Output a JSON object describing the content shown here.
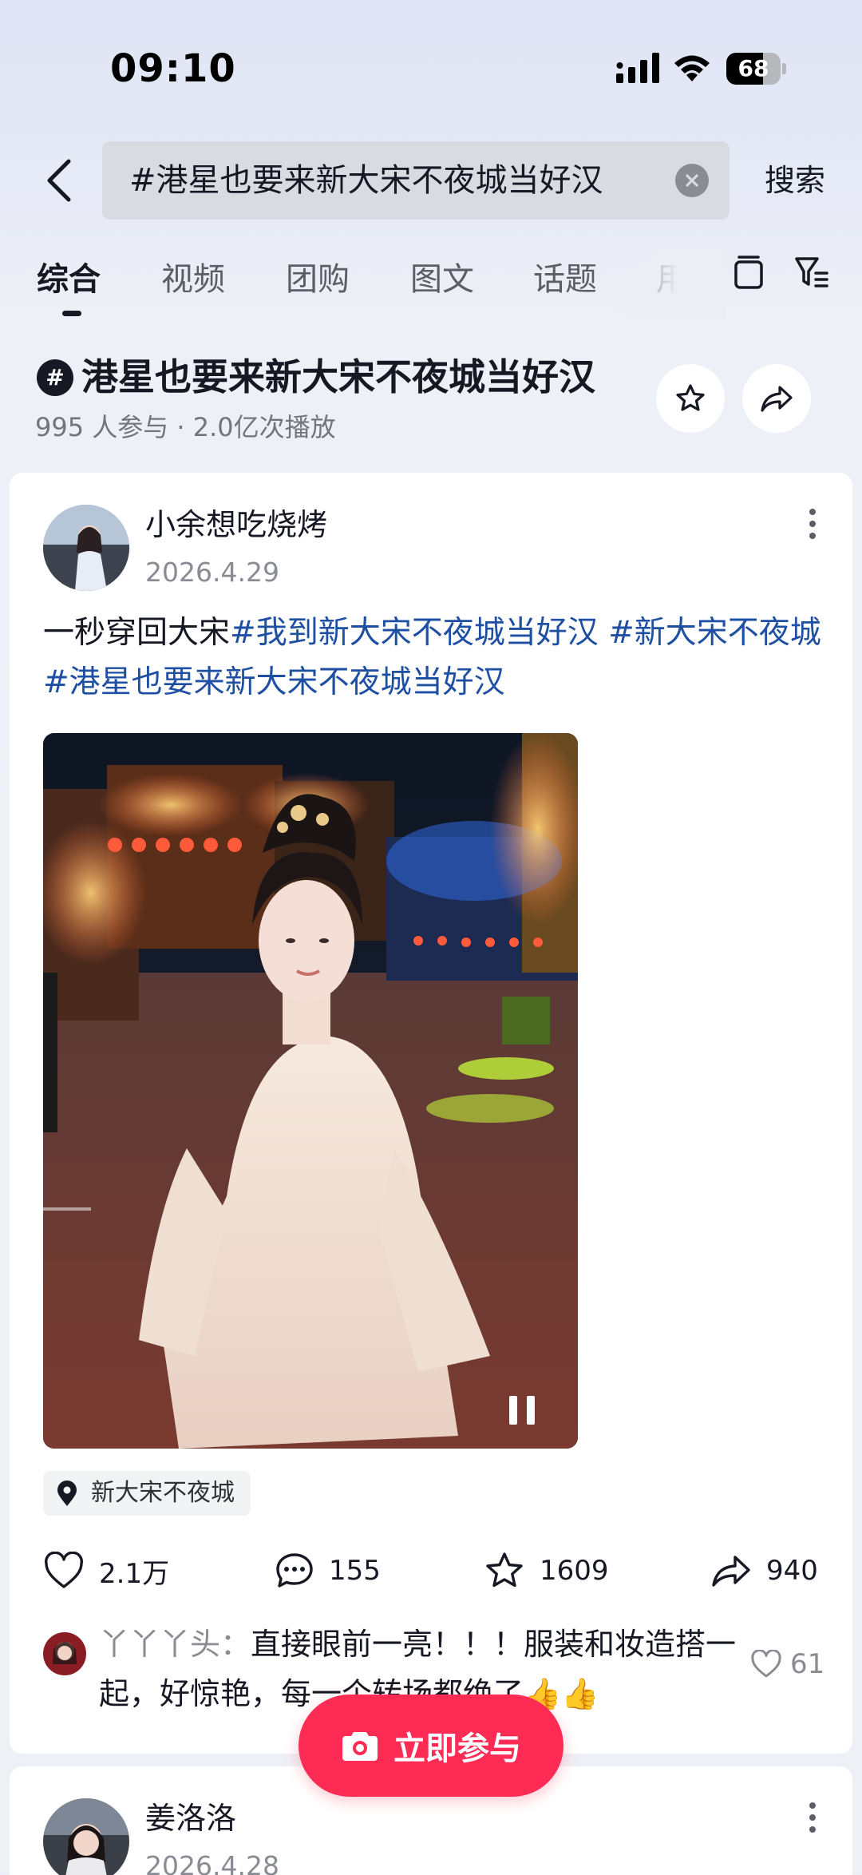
{
  "status_bar": {
    "time": "09:10",
    "battery": "68",
    "battery_level": 0.68
  },
  "search": {
    "query": "#港星也要来新大宋不夜城当好汉",
    "button_label": "搜索"
  },
  "tabs": [
    {
      "label": "综合",
      "active": true
    },
    {
      "label": "视频"
    },
    {
      "label": "团购"
    },
    {
      "label": "图文"
    },
    {
      "label": "话题"
    },
    {
      "label": "用户"
    }
  ],
  "topic": {
    "hash_symbol": "#",
    "title": "港星也要来新大宋不夜城当好汉",
    "stats": "995 人参与 · 2.0亿次播放"
  },
  "post1": {
    "author": "小余想吃烧烤",
    "date": "2026.4.29",
    "text_plain": "一秒穿回大宋",
    "hashtags": [
      "#我到新大宋不夜城当好汉 ",
      "#新大宋不夜城 ",
      "#港星也要来新大宋不夜城当好汉"
    ],
    "location": "新大宋不夜城",
    "likes": "2.1万",
    "comments": "155",
    "favorites": "1609",
    "shares": "940",
    "top_comment": {
      "user": "丫丫丫头：",
      "text": "直接眼前一亮！！！服装和妆造搭一起，好惊艳，每一个转场都绝了👍👍",
      "likes": "61"
    }
  },
  "post2": {
    "author": "姜洛洛",
    "date": "2026.4.28"
  },
  "join_button": "立即参与",
  "colors": {
    "accent": "#fe2c55",
    "hashtag": "#1e4fa2",
    "text_primary": "#161823",
    "text_secondary": "#8a8c93"
  }
}
